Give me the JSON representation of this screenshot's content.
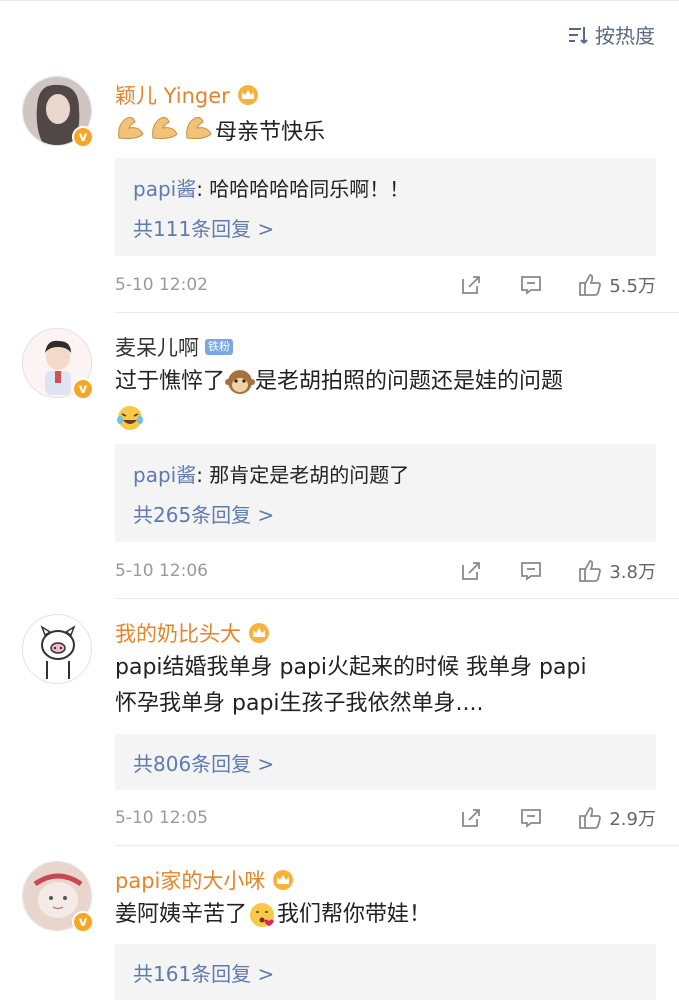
{
  "sort": {
    "label": "按热度",
    "icon": "sort-icon"
  },
  "comments": [
    {
      "username": "颖儿 Yinger",
      "text": "母亲节快乐",
      "reply": {
        "user": "papi酱",
        "text": ": 哈哈哈哈哈同乐啊！！"
      },
      "reply_count": "共111条回复 >",
      "time": "5-10 12:02",
      "likes": "5.5万"
    },
    {
      "username": "麦呆儿啊",
      "badge": "铁粉",
      "text_line1": "过于憔悴了",
      "text_line1b": "是老胡拍照的问题还是娃的问题",
      "reply": {
        "user": "papi酱",
        "text": ": 那肯定是老胡的问题了"
      },
      "reply_count": "共265条回复 >",
      "time": "5-10 12:06",
      "likes": "3.8万"
    },
    {
      "username": "我的奶比头大",
      "text_line1": "papi结婚我单身 papi火起来的时候 我单身 papi",
      "text_line2": "怀孕我单身 papi生孩子我依然单身....",
      "reply_count": "共806条回复 >",
      "time": "5-10 12:05",
      "likes": "2.9万"
    },
    {
      "username": "papi家的大小咪",
      "text_a": "姜阿姨辛苦了",
      "text_b": "我们帮你带娃！",
      "reply_count": "共161条回复 >"
    }
  ],
  "colors": {
    "username": "#e3852a",
    "link": "#5e7bb0",
    "badge": "#f5a623"
  }
}
